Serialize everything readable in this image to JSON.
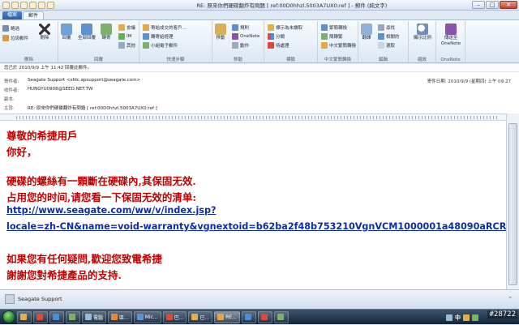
{
  "window": {
    "title": "RE: 原來你們硬碟翻炸有問題 [ ref:00D0hhzl.5003A7UX0:ref ] - 郵件 (純文字)",
    "controls": {
      "minimize": "–",
      "maximize": "□",
      "close": "✕"
    }
  },
  "tabs": [
    {
      "label": "檔案"
    },
    {
      "label": "郵件"
    }
  ],
  "ribbon": {
    "groups": {
      "delete": {
        "label": "刪除",
        "items": [
          "略過",
          "垃圾郵件",
          "刪除"
        ]
      },
      "respond": {
        "label": "回覆",
        "items": [
          "回覆",
          "全部回覆",
          "轉寄",
          "會議",
          "IM",
          "其他"
        ]
      },
      "quicksteps": {
        "label": "快速步驟",
        "items": [
          "寄給成交的客戶...",
          "轉寄給經理",
          "小組電子郵件"
        ]
      },
      "move": {
        "label": "移動",
        "items": [
          "移動",
          "規則",
          "OneNote",
          "動作"
        ]
      },
      "tags": {
        "label": "標籤",
        "items": [
          "標示為未讀取",
          "分類",
          "待處理"
        ]
      },
      "chinese": {
        "label": "中文繁簡轉換",
        "items": [
          "繁簡轉換",
          "簡轉繁",
          "中文繁簡轉換"
        ]
      },
      "editing": {
        "label": "編輯",
        "items": [
          "翻譯",
          "尋找",
          "相關的",
          "選取"
        ]
      },
      "zoom": {
        "label": "縮放",
        "items": [
          "顯示比例"
        ]
      },
      "onenote": {
        "label": "OneNote",
        "items": [
          "傳送至 OneNote"
        ]
      }
    }
  },
  "message": {
    "infobar": "您已於 2010/9/9 上午 11:42 回覆此郵件。",
    "fields": [
      {
        "label": "寄件者:",
        "value": "Seagate Support <sfdc.apsupport@seagate.com>"
      },
      {
        "label": "收件者:",
        "value": "HUNGYU0908@SEED.NET.TW"
      },
      {
        "label": "副本:",
        "value": ""
      },
      {
        "label": "主旨:",
        "value": "RE: 原來你們硬碟翻炸有問題 [ ref:00D0hhzl.5003A7UX0:ref ]"
      }
    ],
    "sent_label": "寄件日期:",
    "sent_value": "2010/9/9 (星期四) 上午 09:27"
  },
  "body": {
    "lines": [
      "尊敬的希捷用戶",
      "你好，",
      "硬碟的螺絲有一顆斷在硬碟內,其保固无效.",
      "占用您的时间,请您看一下保固无效的清单:"
    ],
    "link_lines": [
      "http://www.seagate.com/ww/v/index.jsp?",
      "locale=zh-CN&name=void-warranty&vgnextoid=b62ba2f48b753210VgnVCM1000001a48090aRCRD"
    ],
    "closing": [
      "如果您有任何疑問,歡迎您致電希捷",
      "謝謝您對希捷產品的支持."
    ]
  },
  "status": {
    "sender": "Seagate Support",
    "chevron": "⌃"
  },
  "taskbar": {
    "buttons": [
      "",
      "",
      "",
      "",
      "電腦",
      "區...",
      "Mic...",
      "巴...",
      "已...",
      "RE...",
      "",
      "",
      ""
    ],
    "tray_lang": "中",
    "watermark": "#28722"
  },
  "colors": {
    "body_red": "#c00000",
    "link_blue": "#0b2bb2",
    "accent": "#2a5ea0"
  }
}
